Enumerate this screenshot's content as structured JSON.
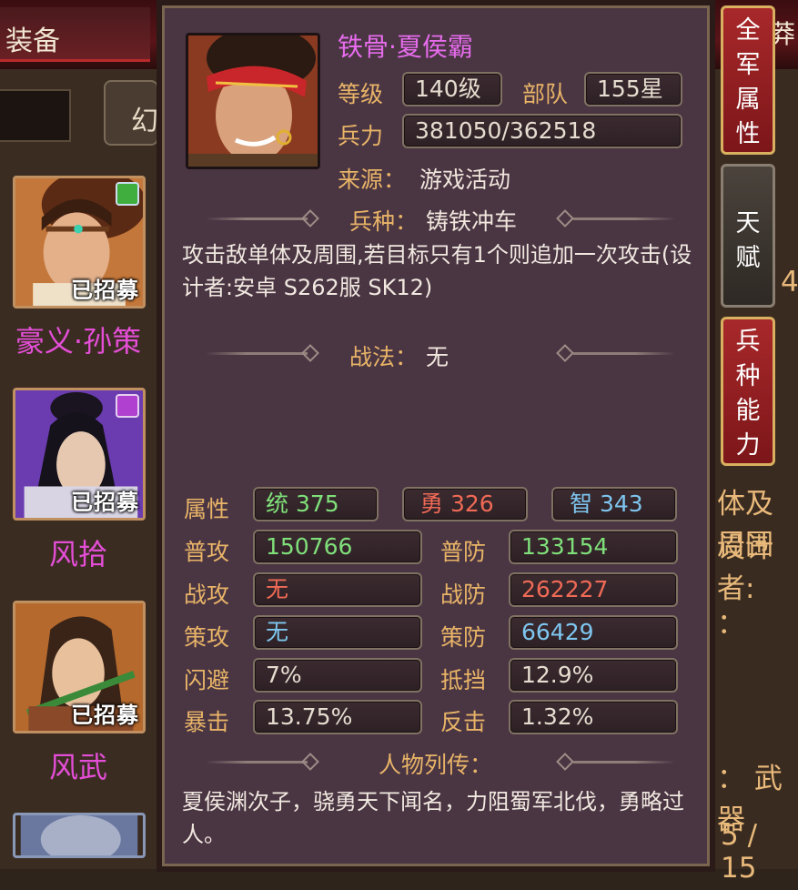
{
  "background": {
    "tab_label": "装备",
    "phantom_button_label": "幻",
    "right_top_text": "莽",
    "right_text_1": "4",
    "right_text_2": "体及周围",
    "right_text_3": "设计者:",
    "right_text_4": "：",
    "right_text_5": "：  武器",
    "right_text_6": "5 / 15",
    "recruit_stamp": "已招募",
    "hero_cards": [
      {
        "name": "豪义·孙策",
        "badge_color": "#3fae3f"
      },
      {
        "name": "风拾",
        "badge_color": "#b040d0"
      },
      {
        "name": "风武",
        "badge_color": ""
      }
    ]
  },
  "side_buttons": [
    {
      "label": "全军属性",
      "chars": [
        "全",
        "军",
        "属",
        "性"
      ],
      "style": "red"
    },
    {
      "label": "天赋",
      "chars": [
        "天",
        "赋"
      ],
      "style": "dark"
    },
    {
      "label": "兵种能力",
      "chars": [
        "兵",
        "种",
        "能",
        "力"
      ],
      "style": "red"
    }
  ],
  "hero": {
    "name": "铁骨·夏侯霸",
    "level_label": "等级",
    "level": "140级",
    "troop_label": "部队",
    "troop": "155星",
    "strength_label": "兵力",
    "strength": "381050/362518",
    "source_label": "来源：",
    "source": "游戏活动",
    "unit_label": "兵种：",
    "unit": "铸铁冲车",
    "unit_desc": "攻击敌单体及周围,若目标只有1个则追加一次攻击(设计者:安卓 S262服 SK12)",
    "tactic_label": "战法：",
    "tactic": "无"
  },
  "attributes": {
    "label": "属性",
    "lead": {
      "text": "统 375",
      "color": "#7fe07a"
    },
    "brave": {
      "text": "勇 326",
      "color": "#f06a56"
    },
    "wisdom": {
      "text": "智 343",
      "color": "#7ec6ef"
    }
  },
  "stats": [
    {
      "label": "普攻",
      "value": "150766",
      "color": "#7fe07a",
      "label2": "普防",
      "value2": "133154",
      "color2": "#7fe07a"
    },
    {
      "label": "战攻",
      "value": "无",
      "color": "#f06a56",
      "label2": "战防",
      "value2": "262227",
      "color2": "#f06a56"
    },
    {
      "label": "策攻",
      "value": "无",
      "color": "#7ec6ef",
      "label2": "策防",
      "value2": "66429",
      "color2": "#7ec6ef"
    },
    {
      "label": "闪避",
      "value": "7%",
      "color": "#e6ddd0",
      "label2": "抵挡",
      "value2": "12.9%",
      "color2": "#e6ddd0"
    },
    {
      "label": "暴击",
      "value": "13.75%",
      "color": "#e6ddd0",
      "label2": "反击",
      "value2": "1.32%",
      "color2": "#e6ddd0"
    }
  ],
  "biography": {
    "label": "人物列传：",
    "text": "夏侯渊次子，骁勇天下闻名，力阻蜀军北伐，勇略过人。"
  }
}
